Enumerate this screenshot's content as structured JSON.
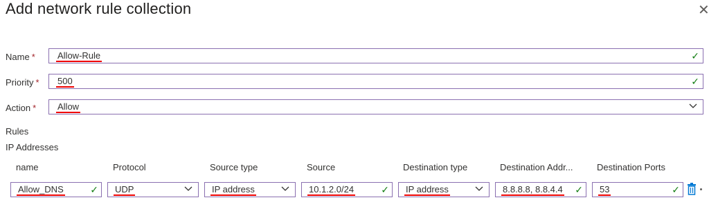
{
  "header": {
    "title": "Add network rule collection",
    "close_icon": "close-icon"
  },
  "form": {
    "name": {
      "label": "Name",
      "required": "*",
      "value": "Allow-Rule"
    },
    "priority": {
      "label": "Priority",
      "required": "*",
      "value": "500"
    },
    "action": {
      "label": "Action",
      "required": "*",
      "value": "Allow"
    }
  },
  "sections": {
    "rules": "Rules",
    "ip_addresses": "IP Addresses"
  },
  "table": {
    "headers": [
      "name",
      "Protocol",
      "Source type",
      "Source",
      "Destination type",
      "Destination Addr...",
      "Destination Ports"
    ],
    "row": {
      "name": "Allow_DNS",
      "protocol": "UDP",
      "source_type": "IP address",
      "source": "10.1.2.0/24",
      "destination_type": "IP address",
      "destination_addresses": "8.8.8.8, 8.8.4.4",
      "destination_ports": "53"
    }
  },
  "colors": {
    "accent_border": "#8a6fb0",
    "valid": "#107c10",
    "required": "#a4262c",
    "delete": "#0078d4"
  },
  "icons": {
    "valid": "checkmark-icon",
    "dropdown": "chevron-down-icon",
    "delete": "trash-icon"
  }
}
